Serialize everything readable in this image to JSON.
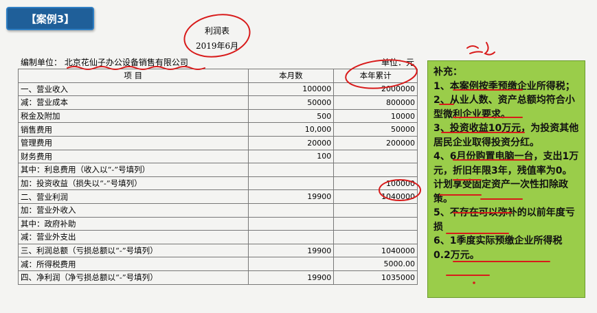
{
  "case_tag": "【案例3】",
  "report": {
    "title": "利润表",
    "date": "2019年6月",
    "company": "编制单位：  北京花仙子办公设备销售有限公司",
    "unit": "单位：元",
    "headers": [
      "项    目",
      "本月数",
      "本年累计"
    ],
    "rows": [
      {
        "item": "一、营业收入",
        "month": "100000",
        "ytd": "2000000"
      },
      {
        "item": "减：营业成本",
        "month": "50000",
        "ytd": "800000"
      },
      {
        "item": "  税金及附加",
        "month": "500",
        "ytd": "10000"
      },
      {
        "item": "  销售费用",
        "month": "10,000",
        "ytd": "50000"
      },
      {
        "item": "  管理费用",
        "month": "20000",
        "ytd": "200000"
      },
      {
        "item": "  财务费用",
        "month": "100",
        "ytd": ""
      },
      {
        "item": "    其中：利息费用（收入以“-”号填列）",
        "month": "",
        "ytd": ""
      },
      {
        "item": "加：投资收益（损失以“-”号填列）",
        "month": "",
        "ytd": "100000"
      },
      {
        "item": "二、营业利润",
        "month": "19900",
        "ytd": "1040000"
      },
      {
        "item": "加：营业外收入",
        "month": "",
        "ytd": ""
      },
      {
        "item": "    其中：政府补助",
        "month": "",
        "ytd": ""
      },
      {
        "item": "减：营业外支出",
        "month": "",
        "ytd": ""
      },
      {
        "item": "三、利润总额（亏损总额以“-”号填列）",
        "month": "19900",
        "ytd": "1040000"
      },
      {
        "item": "减：所得税费用",
        "month": "",
        "ytd": "5000.00"
      },
      {
        "item": "四、净利润（净亏损总额以“-”号填列）",
        "month": "19900",
        "ytd": "1035000"
      }
    ]
  },
  "notes": {
    "heading": "补充：",
    "items": [
      "1、本案例按季预缴企业所得税；",
      "2、从业人数、资产总额均符合小型微利企业要求。",
      "3、投资收益10万元，为投资其他居民企业取得投资分红。",
      "4、6月份购置电脑一台，支出1万元，折旧年限3年，残值率为0。计划享受固定资产一次性扣除政策。",
      "5、不存在可以弥补的以前年度亏损",
      "6、1季度实际预缴企业所得税0.2万元。"
    ]
  },
  "colors": {
    "tag_bg": "#1f5f99",
    "panel_bg": "#9acd4a",
    "ink": "#d81a1a"
  }
}
